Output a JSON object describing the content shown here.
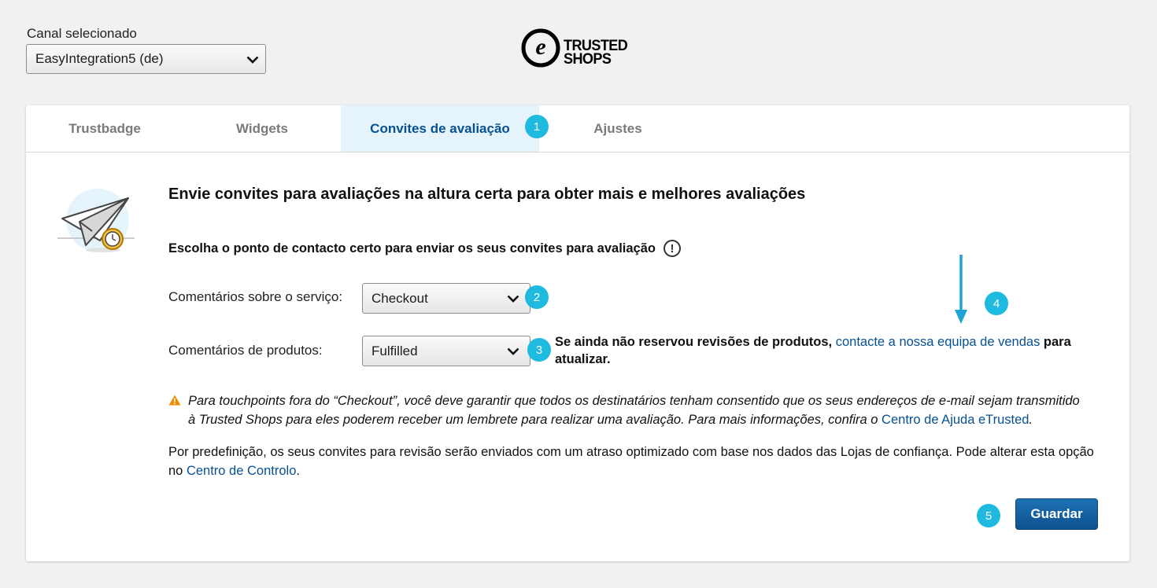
{
  "channel": {
    "label": "Canal selecionado",
    "selected": "EasyIntegration5 (de)"
  },
  "logo": {
    "mark": "e",
    "line1": "TRUSTED",
    "line2": "SHOPS"
  },
  "tabs": [
    {
      "label": "Trustbadge",
      "active": false
    },
    {
      "label": "Widgets",
      "active": false
    },
    {
      "label": "Convites de avaliação",
      "active": true
    },
    {
      "label": "Ajustes",
      "active": false
    }
  ],
  "badges": [
    "1",
    "2",
    "3",
    "4",
    "5"
  ],
  "content": {
    "heading": "Envie convites para avaliações na altura certa para obter mais e melhores avaliações",
    "subheading": "Escolha o ponto de contacto certo para enviar os seus convites para avaliação",
    "info_icon": "!",
    "service_label": "Comentários sobre o serviço:",
    "service_value": "Checkout",
    "product_label": "Comentários de produtos:",
    "product_value": "Fulfilled",
    "sales_note_pre": "Se ainda não reservou revisões de produtos,",
    "sales_note_link": "contacte a nossa equipa de vendas",
    "sales_note_post": "para atualizar.",
    "warning_text": "Para touchpoints fora do “Checkout”, você deve garantir que todos os destinatários tenham consentido que os seus endereços de e-mail sejam transmitido à Trusted Shops para eles poderem receber um lembrete para realizar uma avaliação. Para mais informações, confira o",
    "warning_link": "Centro de Ajuda eTrusted",
    "warning_end": ".",
    "para_text": "Por predefinição, os seus convites para revisão serão enviados com um atraso optimizado com base nos dados das Lojas de confiança. Pode alterar esta opção no",
    "para_link": "Centro de Controlo",
    "para_end": ".",
    "save_label": "Guardar"
  },
  "colors": {
    "accent": "#1fbadf",
    "link": "#075191",
    "button": "#0d5290",
    "warning": "#f08c00"
  },
  "icons": [
    "chevron-down-icon",
    "paper-plane-clock-icon",
    "warning-triangle-icon",
    "info-circle-icon",
    "arrow-down-icon"
  ]
}
